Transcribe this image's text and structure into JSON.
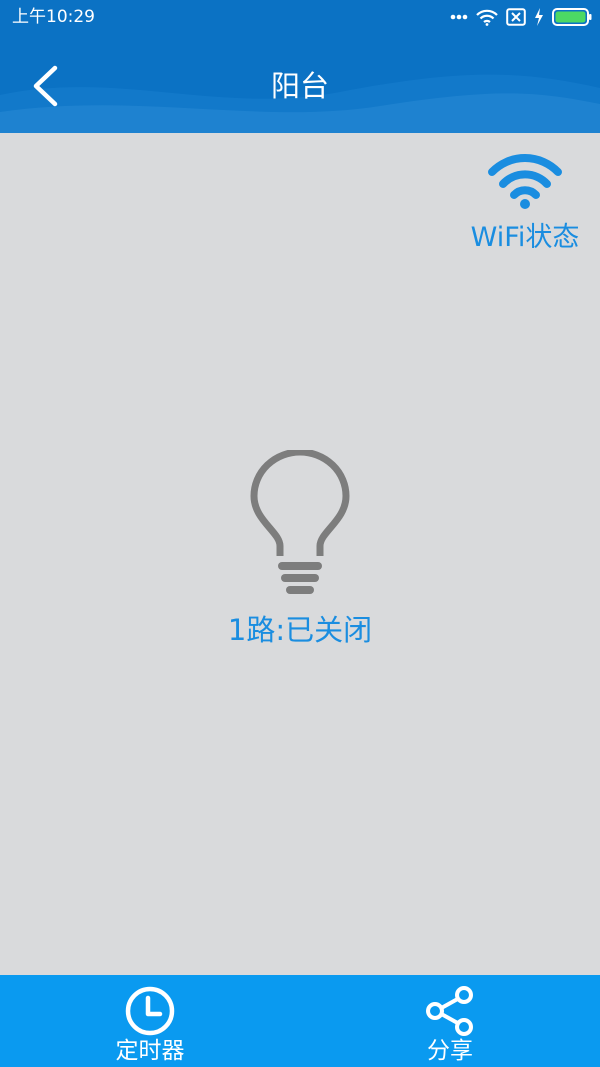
{
  "status_bar": {
    "time": "上午10:29",
    "icons": [
      "more-dots-icon",
      "wifi-signal-icon",
      "sim-no-signal-icon",
      "charging-bolt-icon",
      "battery-icon"
    ]
  },
  "header": {
    "title": "阳台",
    "back_icon": "chevron-left-icon"
  },
  "wifi_status": {
    "label": "WiFi状态",
    "icon": "wifi-icon"
  },
  "device": {
    "icon": "lightbulb-icon",
    "status_text": "1路:已关闭"
  },
  "bottom_nav": {
    "items": [
      {
        "label": "定时器",
        "icon": "clock-icon"
      },
      {
        "label": "分享",
        "icon": "share-icon"
      }
    ]
  },
  "colors": {
    "header_bg": "#0b72c4",
    "page_bg": "#d9dadc",
    "accent_text": "#1a8de0",
    "nav_bg": "#0a9af0",
    "bulb_gray": "#7d7d7d"
  }
}
